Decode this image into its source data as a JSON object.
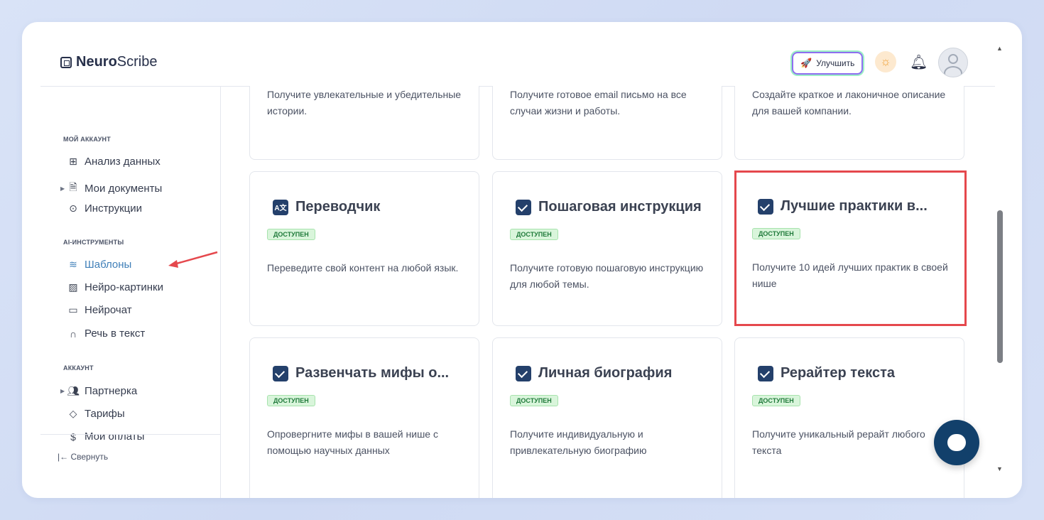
{
  "app": {
    "logo_bold": "Neuro",
    "logo_light": "Scribe"
  },
  "header": {
    "upgrade_label": "Улучшить"
  },
  "sidebar": {
    "sections": [
      {
        "title": "МОЙ АККАУНТ"
      },
      {
        "title": "AI-ИНСТРУМЕНТЫ"
      },
      {
        "title": "АККАУНТ"
      }
    ],
    "items": [
      {
        "label": "Анализ данных",
        "icon": "grid-icon"
      },
      {
        "label": "Мои документы",
        "icon": "document-icon"
      },
      {
        "label": "Инструкции",
        "icon": "help-icon"
      },
      {
        "label": "Шаблоны",
        "icon": "layers-icon"
      },
      {
        "label": "Нейро-картинки",
        "icon": "image-icon"
      },
      {
        "label": "Нейрочат",
        "icon": "chat-bubble-icon"
      },
      {
        "label": "Речь в текст",
        "icon": "headphones-icon"
      },
      {
        "label": "Партнерка",
        "icon": "users-icon"
      },
      {
        "label": "Тарифы",
        "icon": "tag-icon"
      },
      {
        "label": "Мои оплаты",
        "icon": "dollar-icon"
      }
    ],
    "collapse_label": "Свернуть"
  },
  "cards": [
    {
      "title": "",
      "badge": "",
      "desc": "Получите увлекательные и убедительные истории."
    },
    {
      "title": "",
      "badge": "",
      "desc": "Получите готовое email письмо на все случаи жизни и работы."
    },
    {
      "title": "",
      "badge": "",
      "desc": "Создайте краткое и лаконичное описание для вашей компании."
    },
    {
      "title": "Переводчик",
      "badge": "ДОСТУПЕН",
      "desc": "Переведите свой контент на любой язык.",
      "icon_text": "A文"
    },
    {
      "title": "Пошаговая инструкция",
      "badge": "ДОСТУПЕН",
      "desc": "Получите готовую пошаговую инструкцию для любой темы."
    },
    {
      "title": "Лучшие практики в...",
      "badge": "ДОСТУПЕН",
      "desc": "Получите 10 идей лучших практик в своей нише"
    },
    {
      "title": "Развенчать мифы о...",
      "badge": "ДОСТУПЕН",
      "desc": "Опровергните мифы в вашей нише с помощью научных данных"
    },
    {
      "title": "Личная биография",
      "badge": "ДОСТУПЕН",
      "desc": "Получите индивидуальную и привлекательную биографию"
    },
    {
      "title": "Рерайтер текста",
      "badge": "ДОСТУПЕН",
      "desc": "Получите уникальный рерайт любого текста"
    }
  ],
  "colors": {
    "accent": "#3f7fb8",
    "highlight": "#e5484d",
    "badge_bg": "#d9f5db",
    "brand_dark": "#12406b"
  }
}
